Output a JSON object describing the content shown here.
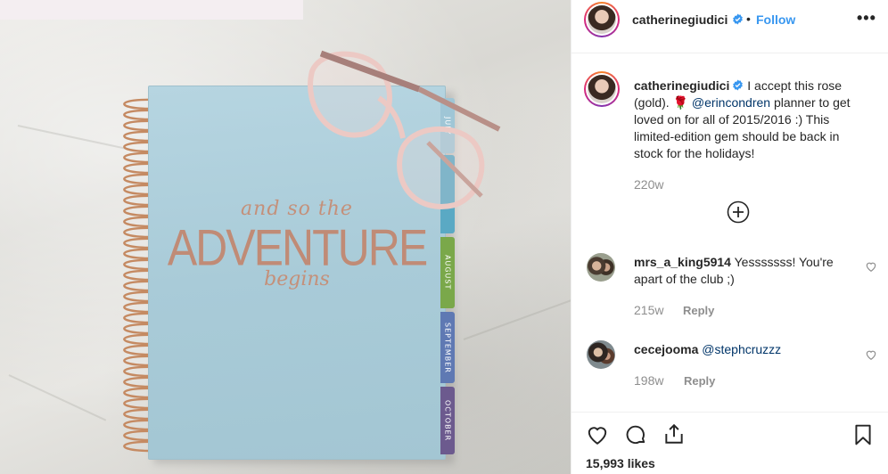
{
  "post": {
    "author": "catherinegiudici",
    "follow_dot": "•",
    "follow_label": "Follow",
    "more_label": "•••",
    "caption_before": " I accept this rose (gold). ",
    "caption_emoji": "🌹",
    "caption_mention": "@erincondren",
    "caption_after": " planner to get loved on for all of 2015/2016 :) This limited-edition gem should be back in stock for the holidays!",
    "caption_age": "220w",
    "likes": "15,993 likes"
  },
  "photo": {
    "cover_line1": "and so the",
    "cover_line2": "ADVENTURE",
    "cover_line3": "begins",
    "tabs": [
      {
        "label": "JULY",
        "color": "#9fc6d6"
      },
      {
        "label": "",
        "color": "#5aa9c4"
      },
      {
        "label": "AUGUST",
        "color": "#7aa84a"
      },
      {
        "label": "SEPTEMBER",
        "color": "#5f79b3"
      },
      {
        "label": "OCTOBER",
        "color": "#6c5a8e"
      }
    ]
  },
  "comments": [
    {
      "user": "mrs_a_king5914",
      "text": " Yesssssss! You're apart of the club ;)",
      "age": "215w",
      "reply": "Reply"
    },
    {
      "user": "cecejooma",
      "text": " ",
      "mention": "@stephcruzzz",
      "age": "198w",
      "reply": "Reply"
    }
  ],
  "icons": {
    "verified": "verified-badge-icon",
    "load_more": "plus-circle-icon",
    "like": "heart-icon",
    "comment": "comment-icon",
    "share": "share-icon",
    "save": "bookmark-icon"
  },
  "colors": {
    "link": "#3897f0",
    "mention": "#003569",
    "muted": "#8e8e8e",
    "verified": "#3897f0"
  }
}
